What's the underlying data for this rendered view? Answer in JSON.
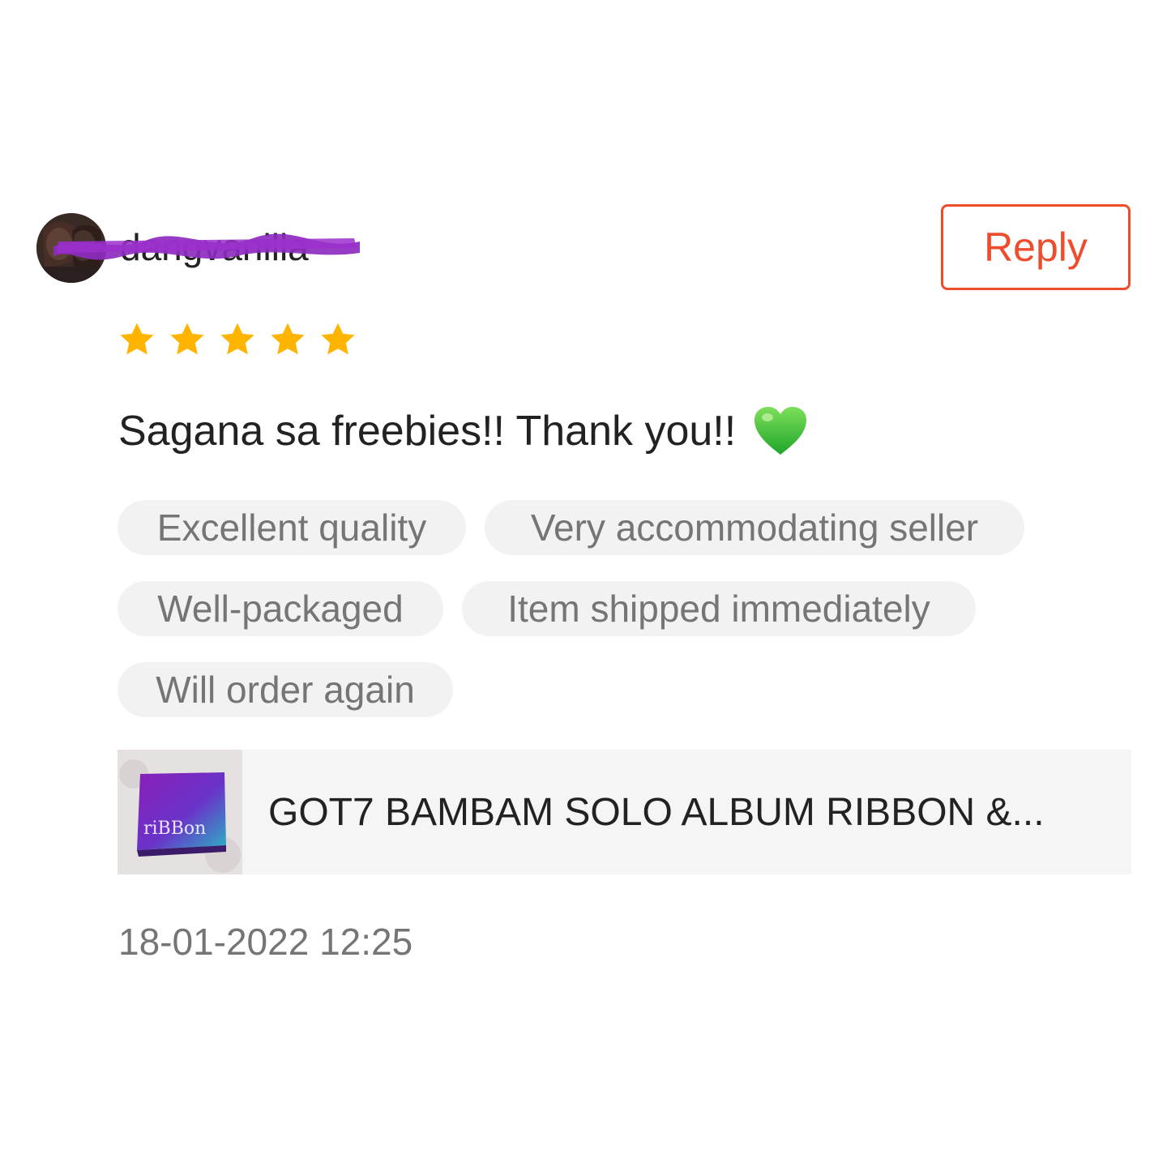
{
  "review": {
    "username": "dangvanilla",
    "reply_label": "Reply",
    "rating": 5,
    "rating_max": 5,
    "comment": "Sagana sa freebies!! Thank you!!",
    "comment_emoji": "green-heart",
    "tags": [
      "Excellent quality",
      "Very accommodating seller",
      "Well-packaged",
      "Item shipped immediately",
      "Will order again"
    ],
    "product": {
      "name": "GOT7 BAMBAM SOLO ALBUM RIBBON &...",
      "thumbnail_text": "riBBon"
    },
    "timestamp": "18-01-2022 12:25"
  },
  "colors": {
    "accent": "#ee4d2d",
    "star": "#ffb400",
    "tag_bg": "#f2f2f2",
    "redaction": "#8e2bbf"
  }
}
